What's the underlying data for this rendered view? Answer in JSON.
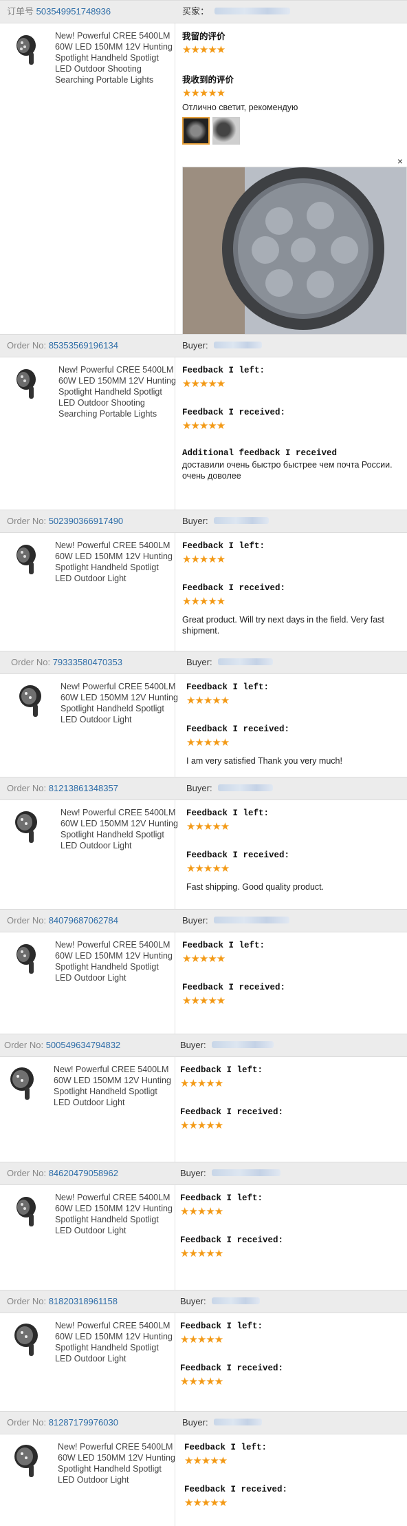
{
  "star_color": "#f39a17",
  "link_color": "#2f6ea8",
  "product_title_long": "New! Powerful CREE 5400LM 60W LED 150MM 12V Hunting Spotlight Handheld Spotligt LED Outdoor Shooting Searching Portable Lights",
  "product_title_short": "New! Powerful CREE 5400LM 60W LED 150MM 12V Hunting Spotlight Handheld Spotligt LED Outdoor Light",
  "stars_text": "★★★★★",
  "orders": [
    {
      "order_label": "订单号",
      "order_no": "503549951748936",
      "buyer_label": "买家：",
      "left_label": "我留的评价",
      "received_label": "我收到的评价",
      "comment": "Отлично светит, рекомендую",
      "close_icon": "×",
      "has_photos": true
    },
    {
      "order_label": "Order No:",
      "order_no": "85353569196134",
      "buyer_label": "Buyer:",
      "left_label": "Feedback I left:",
      "received_label": "Feedback I received:",
      "comment": "",
      "additional_label": "Additional feedback I received",
      "additional_text": "доставили очень быстро быстрее чем почта России. очень доволее"
    },
    {
      "order_label": "Order No:",
      "order_no": "502390366917490",
      "buyer_label": "Buyer:",
      "left_label": "Feedback I left:",
      "received_label": "Feedback I received:",
      "comment": "Great product. Will try next days in the field. Very fast shipment."
    },
    {
      "order_label": "Order No:",
      "order_no": "79333580470353",
      "buyer_label": "Buyer:",
      "left_label": "Feedback I left:",
      "received_label": "Feedback I received:",
      "comment": "I am very satisfied Thank you very much!"
    },
    {
      "order_label": "Order No:",
      "order_no": "81213861348357",
      "buyer_label": "Buyer:",
      "left_label": "Feedback I left:",
      "received_label": "Feedback I received:",
      "comment": "Fast shipping. Good quality product."
    },
    {
      "order_label": "Order No:",
      "order_no": "84079687062784",
      "buyer_label": "Buyer:",
      "left_label": "Feedback I left:",
      "received_label": "Feedback I received:",
      "comment": ""
    },
    {
      "order_label": "Order No:",
      "order_no": "500549634794832",
      "buyer_label": "Buyer:",
      "left_label": "Feedback I left:",
      "received_label": "Feedback I received:",
      "comment": ""
    },
    {
      "order_label": "Order No:",
      "order_no": "84620479058962",
      "buyer_label": "Buyer:",
      "left_label": "Feedback I left:",
      "received_label": "Feedback I received:",
      "comment": ""
    },
    {
      "order_label": "Order No:",
      "order_no": "81820318961158",
      "buyer_label": "Buyer:",
      "left_label": "Feedback I left:",
      "received_label": "Feedback I received:",
      "comment": ""
    },
    {
      "order_label": "Order No:",
      "order_no": "81287179976030",
      "buyer_label": "Buyer:",
      "left_label": "Feedback I left:",
      "received_label": "Feedback I received:",
      "comment": ""
    }
  ]
}
